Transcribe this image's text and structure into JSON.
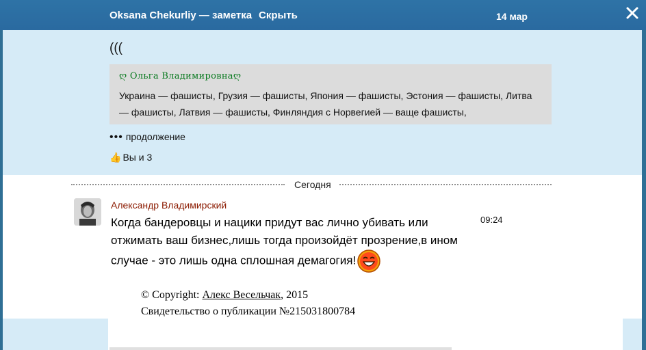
{
  "topbar": {
    "author_title": "Oksana Chekurliy — заметка",
    "hide_label": "Скрыть",
    "date": "14 мар",
    "close_icon": "close-icon"
  },
  "note": {
    "text": "(((",
    "quote": {
      "author": "ღ Ольга Владимировнаღ",
      "text": "Украина — фашисты, Грузия — фашисты, Япония — фашисты, Эстония — фашисты, Литва — фашисты, Латвия — фашисты, Финляндия с Норвегией — ваще фашисты,"
    },
    "more_label": "продолжение",
    "likes_label": "Вы и 3"
  },
  "divider_label": "Сегодня",
  "message": {
    "author": "Александр Владимирский",
    "time": "09:24",
    "text": "Когда бандеровцы и нацики придут вас лично убивать или отжимать ваш бизнес,лишь тогда произойдёт прозрение,в ином случае - это лишь одна сплошная демагогия!"
  },
  "copyright": {
    "prefix": "© Copyright: ",
    "author_link": "Алекс Весельчак",
    "year": ", 2015",
    "certificate": "Свидетельство о публикации №215031800784"
  },
  "colors": {
    "topbar": "#2e73a6",
    "note_bg": "#d6ebf7",
    "quote_bg": "#dcdcdc",
    "quote_author": "#0a7a20",
    "message_author": "#8b1a00"
  }
}
